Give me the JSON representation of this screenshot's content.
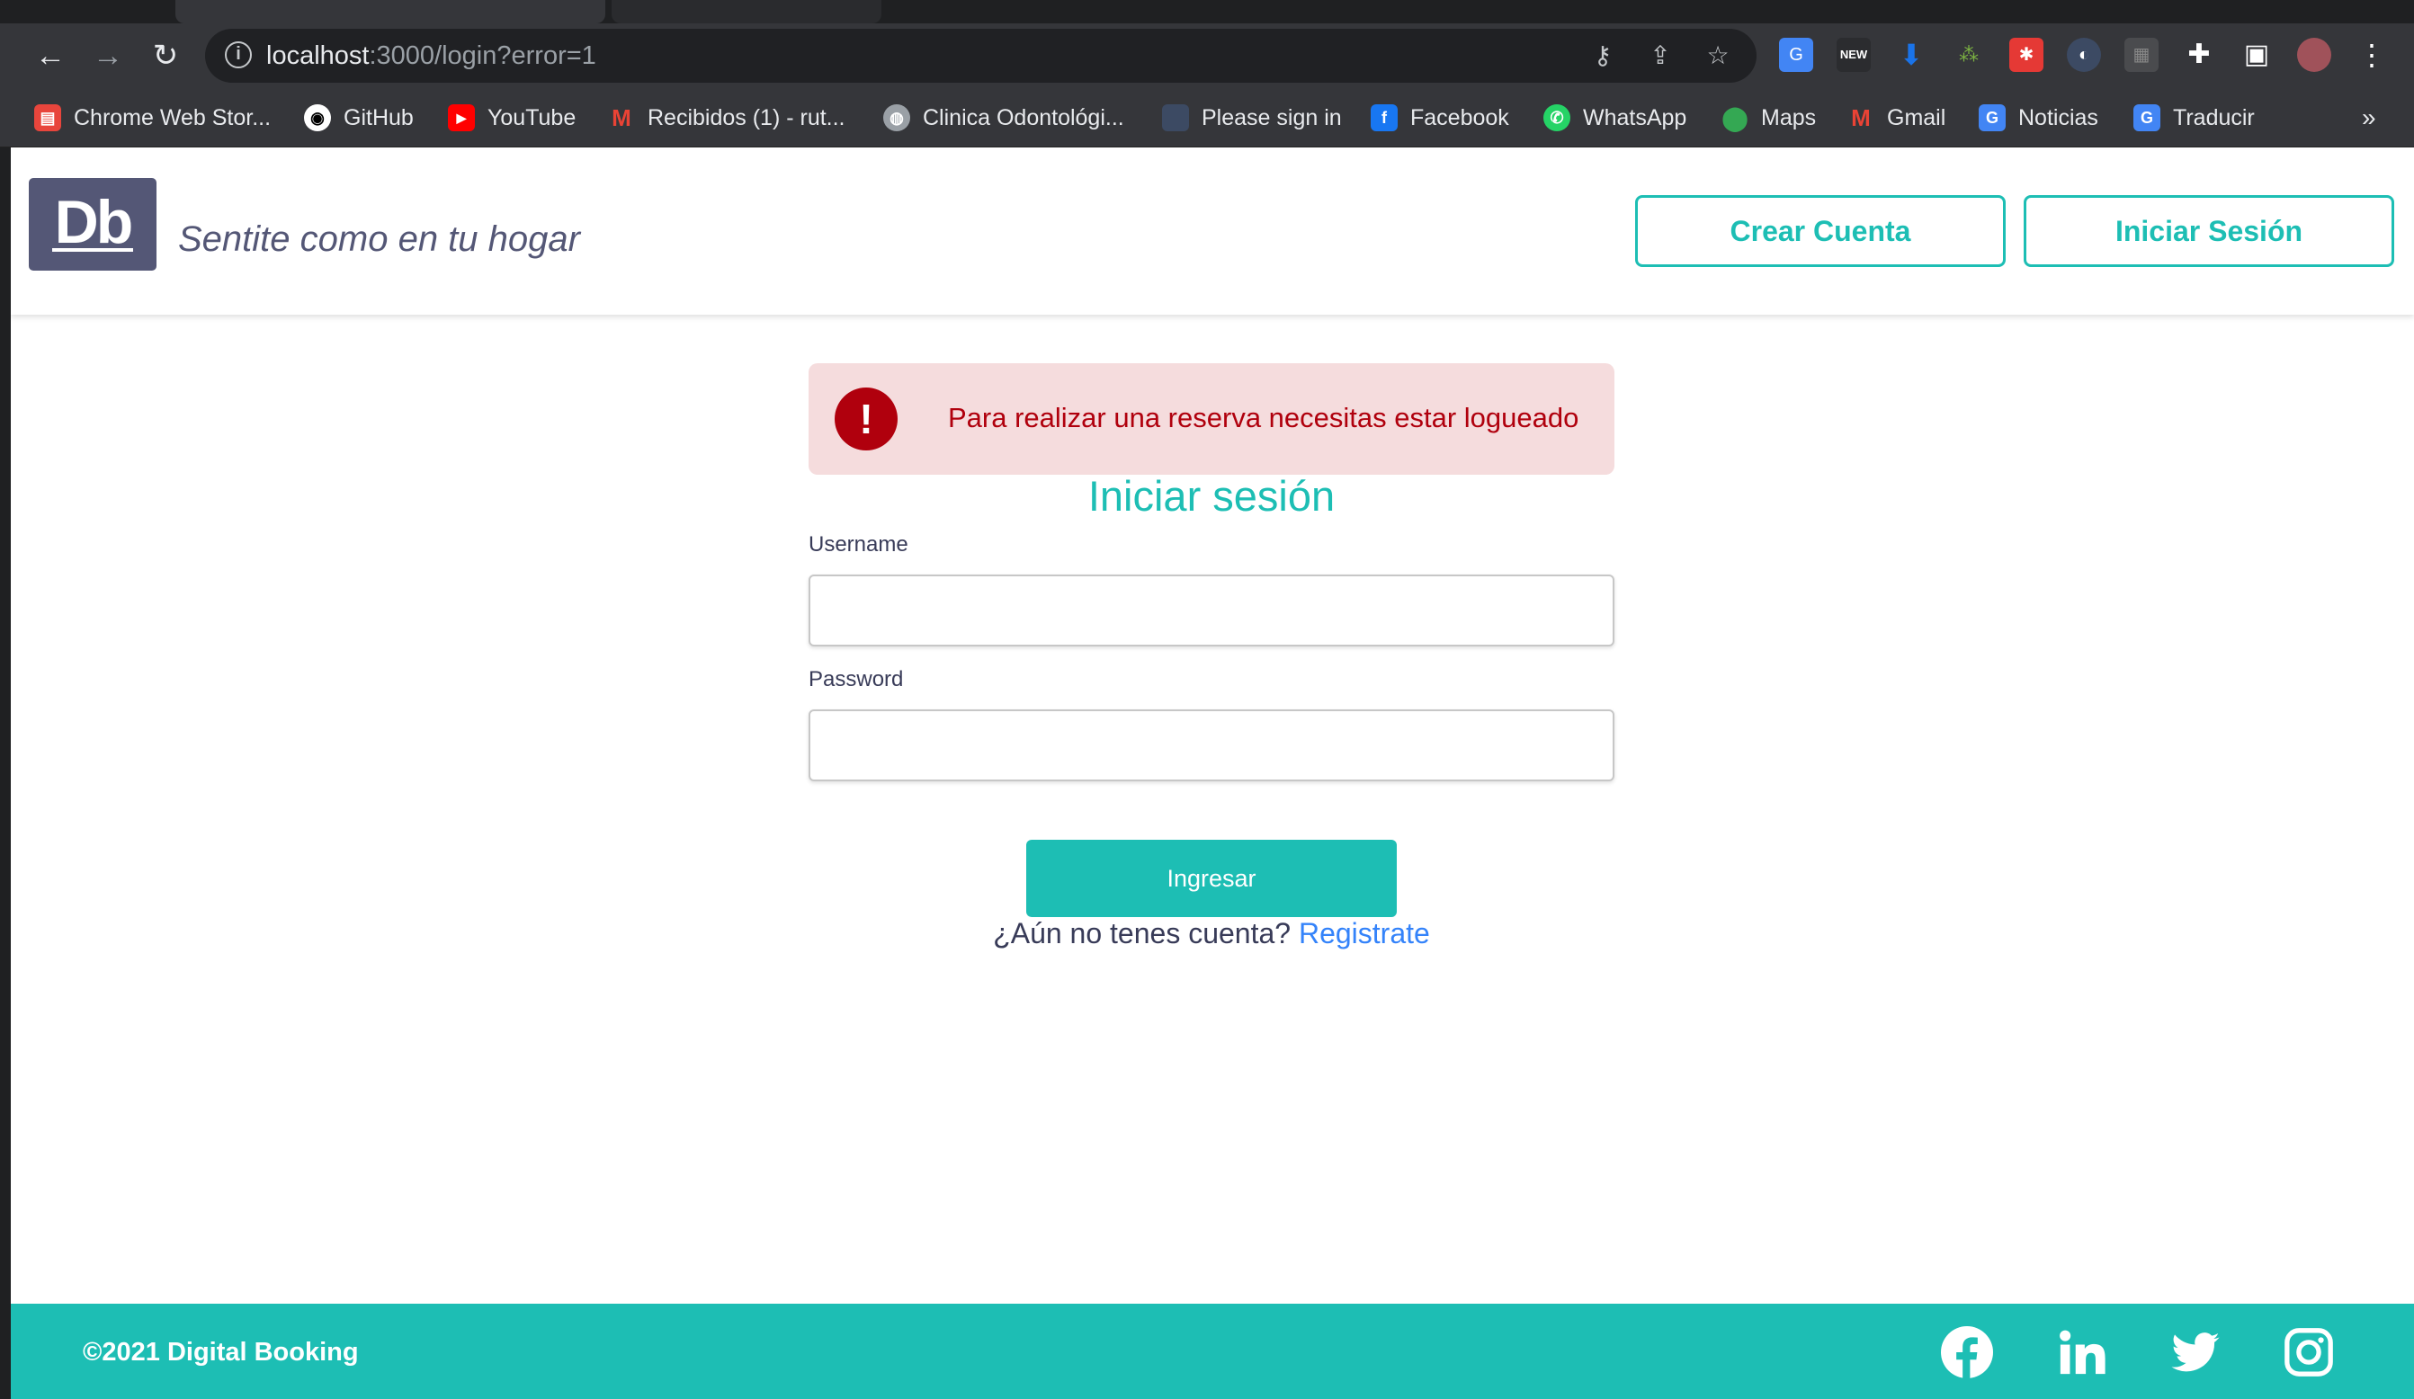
{
  "browser": {
    "url_host": "localhost",
    "url_rest": ":3000/login?error=1",
    "bookmarks": [
      {
        "label": "Chrome Web Stor...",
        "icon": "chrome-web-store-icon",
        "color": "#e8453c"
      },
      {
        "label": "GitHub",
        "icon": "github-icon",
        "color": "#ffffff"
      },
      {
        "label": "YouTube",
        "icon": "youtube-icon",
        "color": "#ff0000"
      },
      {
        "label": "Recibidos (1) - rut...",
        "icon": "gmail-icon",
        "color": "#ea4335"
      },
      {
        "label": "Clinica Odontológi...",
        "icon": "globe-icon",
        "color": "#9aa0a6"
      },
      {
        "label": "Please sign in",
        "icon": "signin-icon",
        "color": "#3c4a63"
      },
      {
        "label": "Facebook",
        "icon": "facebook-icon",
        "color": "#1877f2"
      },
      {
        "label": "WhatsApp",
        "icon": "whatsapp-icon",
        "color": "#25d366"
      },
      {
        "label": "Maps",
        "icon": "maps-icon",
        "color": "#34a853"
      },
      {
        "label": "Gmail",
        "icon": "gmail-icon",
        "color": "#ea4335"
      },
      {
        "label": "Noticias",
        "icon": "google-news-icon",
        "color": "#4285f4"
      },
      {
        "label": "Traducir",
        "icon": "google-translate-icon",
        "color": "#4285f4"
      }
    ],
    "overflow_label": "»"
  },
  "header": {
    "logo_text": "Db",
    "slogan": "Sentite como en tu hogar",
    "create_account_label": "Crear Cuenta",
    "login_label": "Iniciar Sesión"
  },
  "alert": {
    "icon_text": "!",
    "message": "Para realizar una reserva necesitas estar logueado"
  },
  "login": {
    "title": "Iniciar sesión",
    "username_label": "Username",
    "username_value": "",
    "password_label": "Password",
    "password_value": "",
    "submit_label": "Ingresar",
    "register_prompt": "¿Aún no tenes cuenta?",
    "register_link": "Registrate"
  },
  "footer": {
    "copyright": "©2021 Digital Booking",
    "social": [
      "facebook-icon",
      "linkedin-icon",
      "twitter-icon",
      "instagram-icon"
    ]
  },
  "colors": {
    "primary": "#1dbeb4",
    "secondary": "#545776",
    "error": "#b0000d",
    "error_bg": "#f5dcdd",
    "link": "#3483fa"
  }
}
